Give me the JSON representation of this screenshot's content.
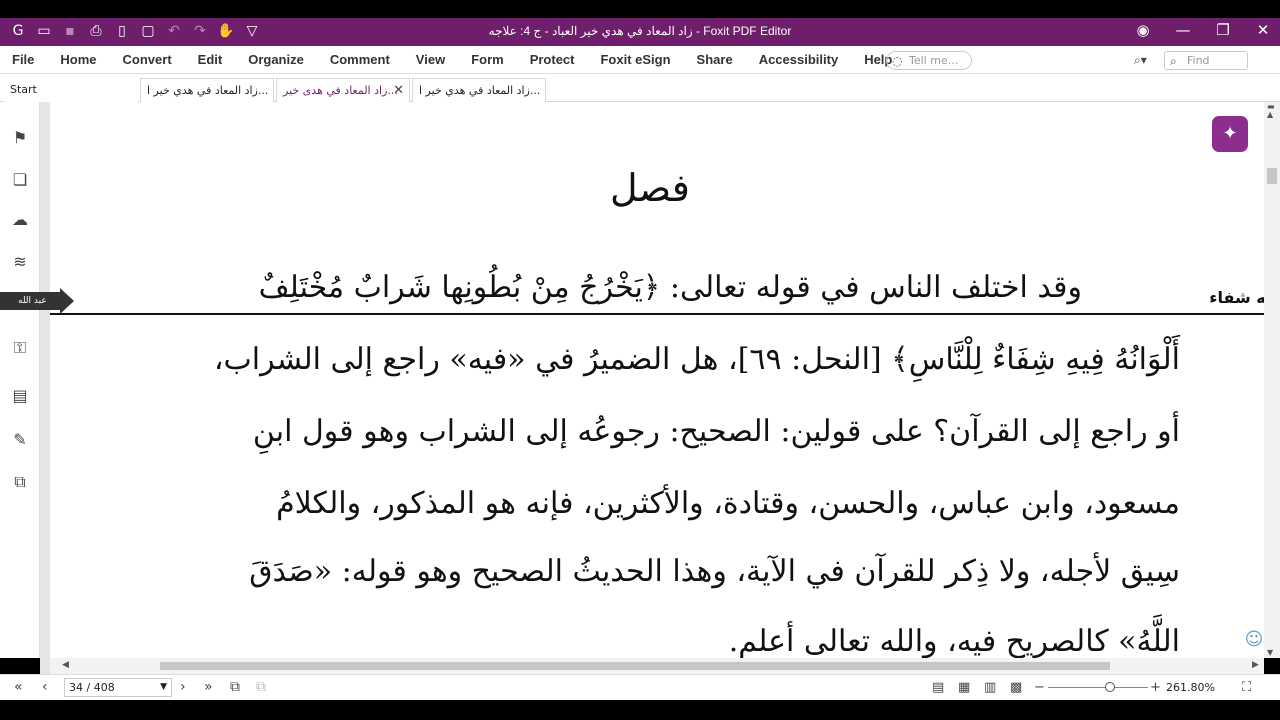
{
  "window": {
    "title": "زاد المعاد في هدي خير العباد - ج 4: علاجه - Foxit PDF Editor"
  },
  "menu": [
    "File",
    "Home",
    "Convert",
    "Edit",
    "Organize",
    "Comment",
    "View",
    "Form",
    "Protect",
    "Foxit eSign",
    "Share",
    "Accessibility",
    "Help"
  ],
  "tell_me_placeholder": "Tell me...",
  "find_placeholder": "Find",
  "tabs": [
    {
      "label": "Start"
    },
    {
      "label": "زاد المعاد في هدي خير ا..."
    },
    {
      "label": "زاد المعاد في هدى خير...",
      "active": true
    },
    {
      "label": "زاد المعاد في هدي خير ا..."
    }
  ],
  "bookmark_flag": "عبد الله",
  "document": {
    "heading": "فصل",
    "margin_note": "يه شفاء",
    "lines": [
      "وقد اختلف الناس في قوله تعالى: ﴿يَخْرُجُ مِنْ بُطُونِها شَرابٌ مُخْتَلِفٌ",
      "أَلْوَانُهُ فِيهِ شِفَاءٌ لِلْنَّاسِ﴾ [النحل: ٦٩]، هل الضميرُ في «فيه» راجع إلى الشراب،",
      "أو راجع إلى القرآن؟ على قولين: الصحيح: رجوعُه إلى الشراب وهو قول ابنِ",
      "مسعود، وابن عباس، والحسن، وقتادة، والأكثرين، فإنه هو المذكور، والكلامُ",
      "سِيق لأجله، ولا ذِكر للقرآن في الآية، وهذا الحديثُ الصحيح وهو قوله: «صَدَقَ",
      "اللَّهُ» كالصريح فيه، والله تعالى أعلم."
    ]
  },
  "status": {
    "page_indicator": "34 / 408",
    "zoom": "261.80%",
    "zoom_fraction": 0.62
  }
}
